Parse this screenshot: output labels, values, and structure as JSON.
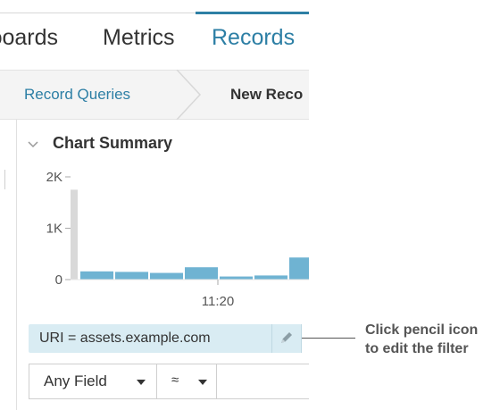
{
  "nav": {
    "tabs": [
      {
        "label": "ɔoards",
        "active": false
      },
      {
        "label": "Metrics",
        "active": false
      },
      {
        "label": "Records",
        "active": true
      }
    ],
    "accent_color": "#2d7fa5"
  },
  "breadcrumb": {
    "items": [
      "Record Queries",
      "New Reco"
    ]
  },
  "summary": {
    "title": "Chart Summary",
    "chevron_icon": "chevron-down-icon"
  },
  "chart_data": {
    "type": "bar",
    "y_ticks": [
      "2K",
      "1K",
      "0"
    ],
    "ylim": [
      0,
      2000
    ],
    "x_ticks": [
      "11:20"
    ],
    "values": [
      1750,
      160,
      150,
      130,
      240,
      60,
      80,
      430
    ],
    "bar_color": "#6fb3d2",
    "highlight_color": "#d9d9d9",
    "grid": false
  },
  "filter": {
    "text": "URI = assets.example.com",
    "edit_icon": "pencil-icon",
    "remove_icon": "x-icon"
  },
  "query": {
    "field_label": "Any Field",
    "operator_label": "≈"
  },
  "callout": {
    "line1": "Click pencil icon",
    "line2": "to edit the filter"
  }
}
